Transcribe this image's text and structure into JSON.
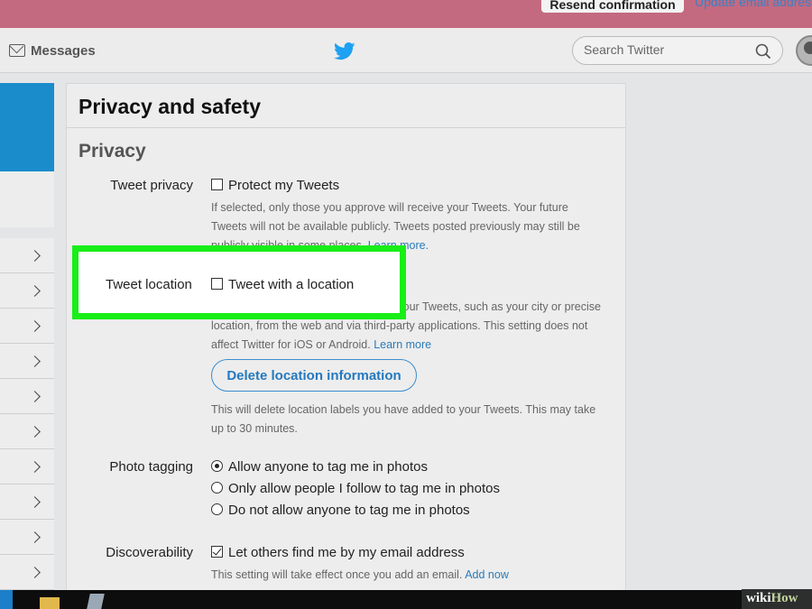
{
  "banner": {
    "resend_label": "Resend confirmation",
    "update_link": "Update email address"
  },
  "nav": {
    "messages_label": "Messages",
    "search_placeholder": "Search Twitter"
  },
  "page": {
    "title": "Privacy and safety",
    "section": "Privacy"
  },
  "tweet_privacy": {
    "label": "Tweet privacy",
    "option": "Protect my Tweets",
    "checked": false,
    "desc_line1": "If selected, only those you approve will receive your Tweets. Your future",
    "desc_line2": "Tweets will not be available publicly. Tweets posted previously may still be",
    "desc_line3": "publicly visible in some places.",
    "learn_more": "Learn more."
  },
  "tweet_location": {
    "label": "Tweet location",
    "option": "Tweet with a location",
    "checked": false,
    "desc_line1": "If selected, you can add a location to your Tweets, such as your city or precise",
    "desc_line2": "location, from the web and via third-party applications. This setting does not",
    "desc_line3": "affect Twitter for iOS or Android.",
    "learn_more": "Learn more",
    "delete_button": "Delete location information",
    "delete_desc_line1": "This will delete location labels you have added to your Tweets. This may take",
    "delete_desc_line2": "up to 30 minutes."
  },
  "photo_tagging": {
    "label": "Photo tagging",
    "options": [
      "Allow anyone to tag me in photos",
      "Only allow people I follow to tag me in photos",
      "Do not allow anyone to tag me in photos"
    ],
    "selected_index": 0
  },
  "discoverability": {
    "label": "Discoverability",
    "option": "Let others find me by my email address",
    "checked": true,
    "desc": "This setting will take effect once you add an email.",
    "add_now": "Add now"
  },
  "watermark": {
    "wiki": "wiki",
    "how": "How"
  },
  "colors": {
    "banner": "#c46a80",
    "twitter_blue": "#1da1f2",
    "highlight": "#18ee18",
    "link": "#2b7bb9"
  }
}
